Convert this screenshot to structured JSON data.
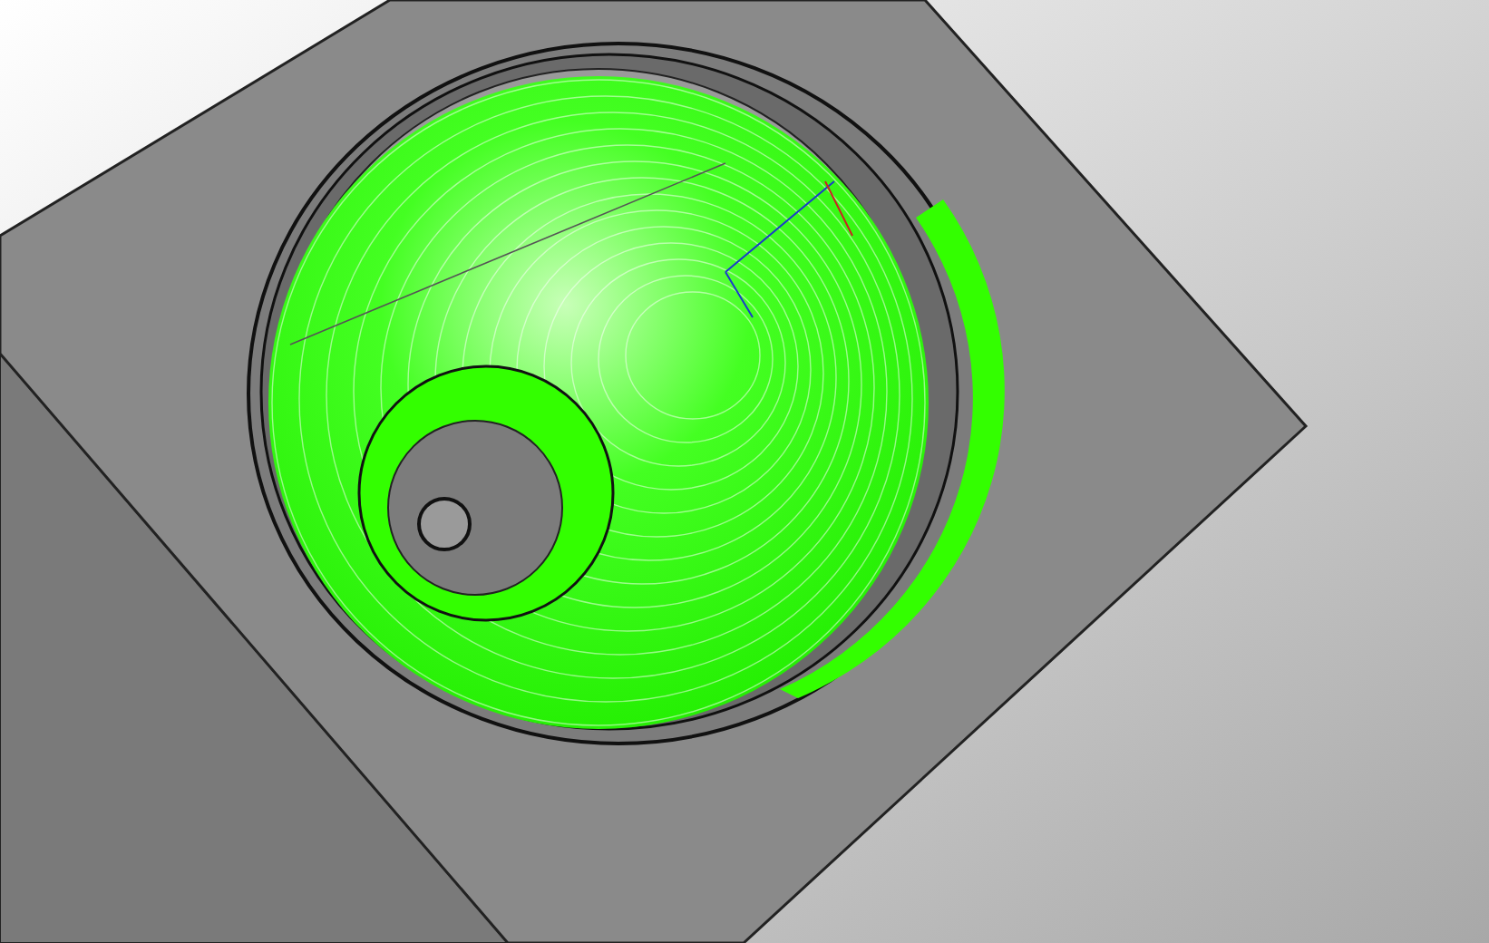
{
  "viewport": {
    "toolpath_visible": true
  }
}
